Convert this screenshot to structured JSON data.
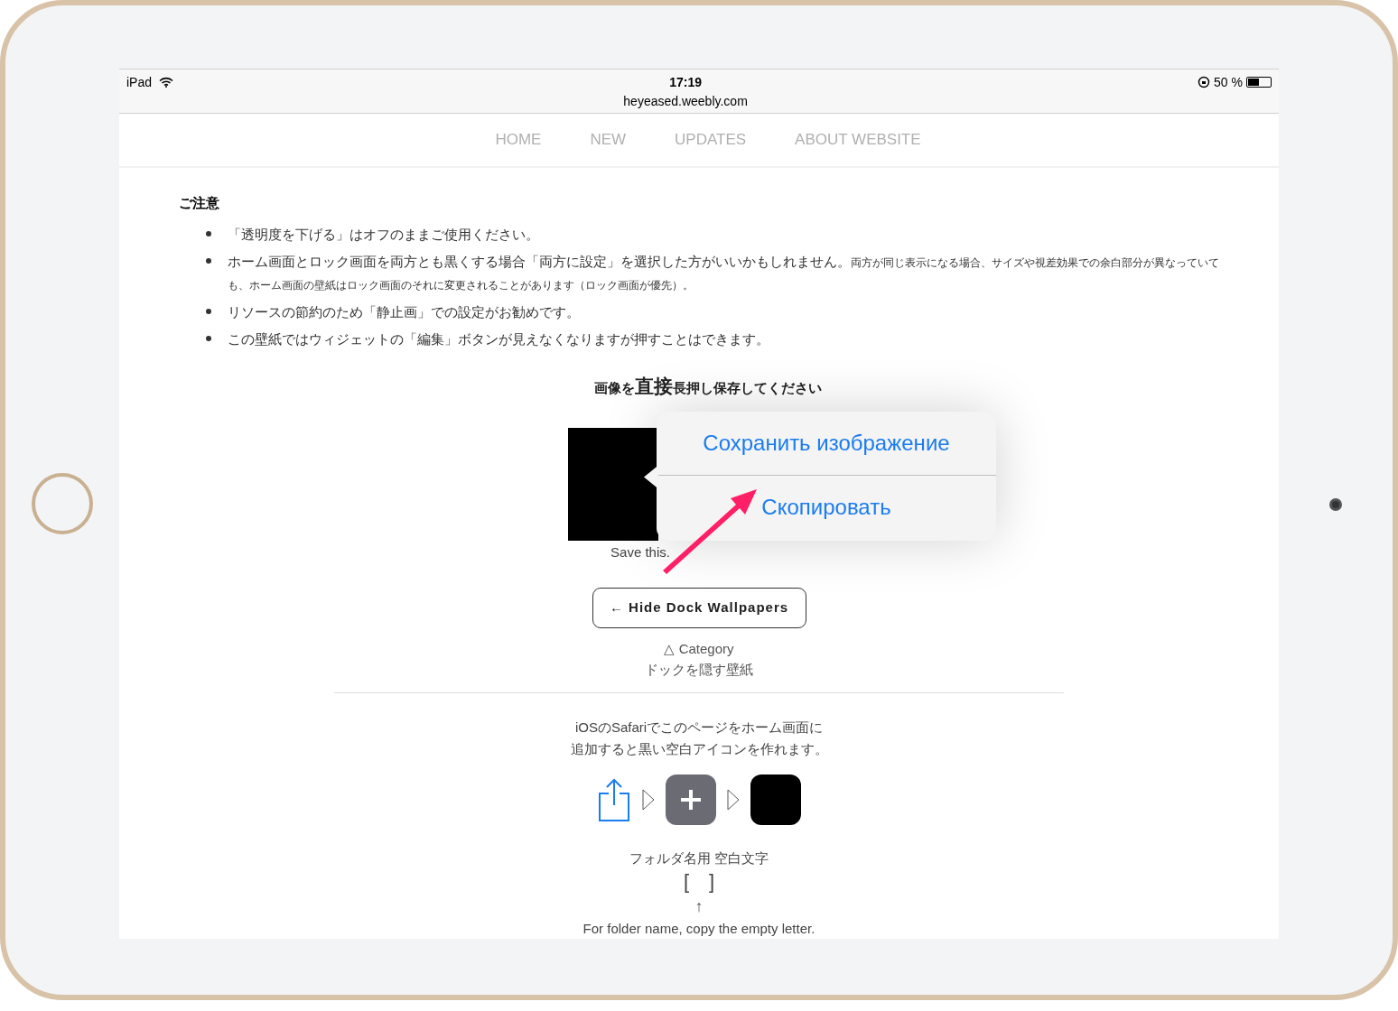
{
  "status_bar": {
    "device": "iPad",
    "time": "17:19",
    "url": "heyeased.weebly.com",
    "battery_text": "50 %",
    "battery": {
      "level": 0.5
    }
  },
  "nav": {
    "items": [
      "HOME",
      "NEW",
      "UPDATES",
      "ABOUT WEBSITE"
    ]
  },
  "notice": {
    "title": "ご注意",
    "items": [
      {
        "text": "「透明度を下げる」はオフのままご使用ください。"
      },
      {
        "text": "ホーム画面とロック画面を両方とも黒くする場合「両方に設定」を選択した方がいいかもしれません。",
        "note": "両方が同じ表示になる場合、サイズや視差効果での余白部分が異なっていても、ホーム画面の壁紙はロック画面のそれに変更されることがあります（ロック画面が優先）。"
      },
      {
        "text": "リソースの節約のため「静止画」での設定がお勧めです。"
      },
      {
        "text": "この壁紙ではウィジェットの「編集」ボタンが見えなくなりますが押すことはできます。"
      }
    ]
  },
  "instruction": {
    "before": "画像を",
    "emphasis": "直接",
    "after": "長押し保存してください"
  },
  "image_caption": "Save this.",
  "context_menu": {
    "items": [
      "Сохранить изображение",
      "Скопировать"
    ]
  },
  "back_button": "← Hide Dock Wallpapers",
  "category": {
    "label": "△ Category",
    "name": "ドックを隠す壁紙"
  },
  "tip": {
    "lines": [
      "iOSのSafariでこのページをホーム画面に",
      "追加すると黒い空白アイコンを作れます。"
    ]
  },
  "folder": {
    "label": "フォルダ名用 空白文字",
    "brackets": "[　]",
    "arrow": "↑",
    "note": "For folder name, copy the empty letter."
  }
}
